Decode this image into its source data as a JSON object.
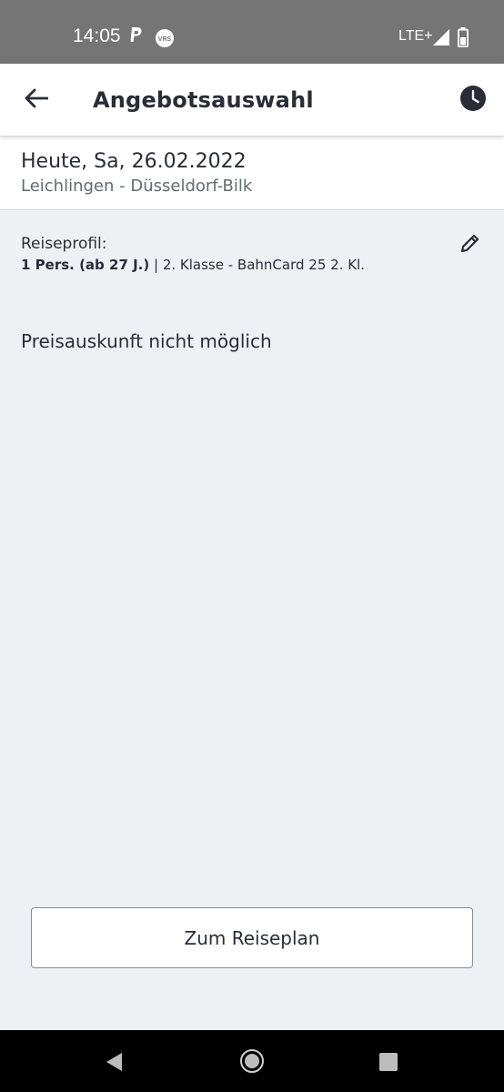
{
  "status_bar": {
    "time": "14:05",
    "network": "LTE+",
    "icons": [
      "paypal-icon",
      "vrs-icon",
      "signal-icon",
      "battery-icon"
    ]
  },
  "app_bar": {
    "title": "Angebotsauswahl",
    "back_icon": "arrow-left-icon",
    "clock_icon": "clock-icon"
  },
  "trip": {
    "date": "Heute, Sa, 26.02.2022",
    "route": "Leichlingen - Düsseldorf-Bilk"
  },
  "profile": {
    "label": "Reiseprofil:",
    "persons": "1 Pers. (ab 27 J.)",
    "separator": " | ",
    "class_info": "2. Klasse - BahnCard 25 2. Kl.",
    "edit_icon": "pencil-icon"
  },
  "message": "Preisauskunft nicht möglich",
  "action_button": {
    "label": "Zum Reiseplan"
  },
  "nav_bar": {
    "icons": [
      "nav-back-icon",
      "nav-home-icon",
      "nav-recents-icon"
    ]
  },
  "colors": {
    "background": "#eef1f3",
    "surface": "#ffffff",
    "text": "#282d37",
    "secondary_text": "#646973",
    "status_bar": "#757575"
  }
}
